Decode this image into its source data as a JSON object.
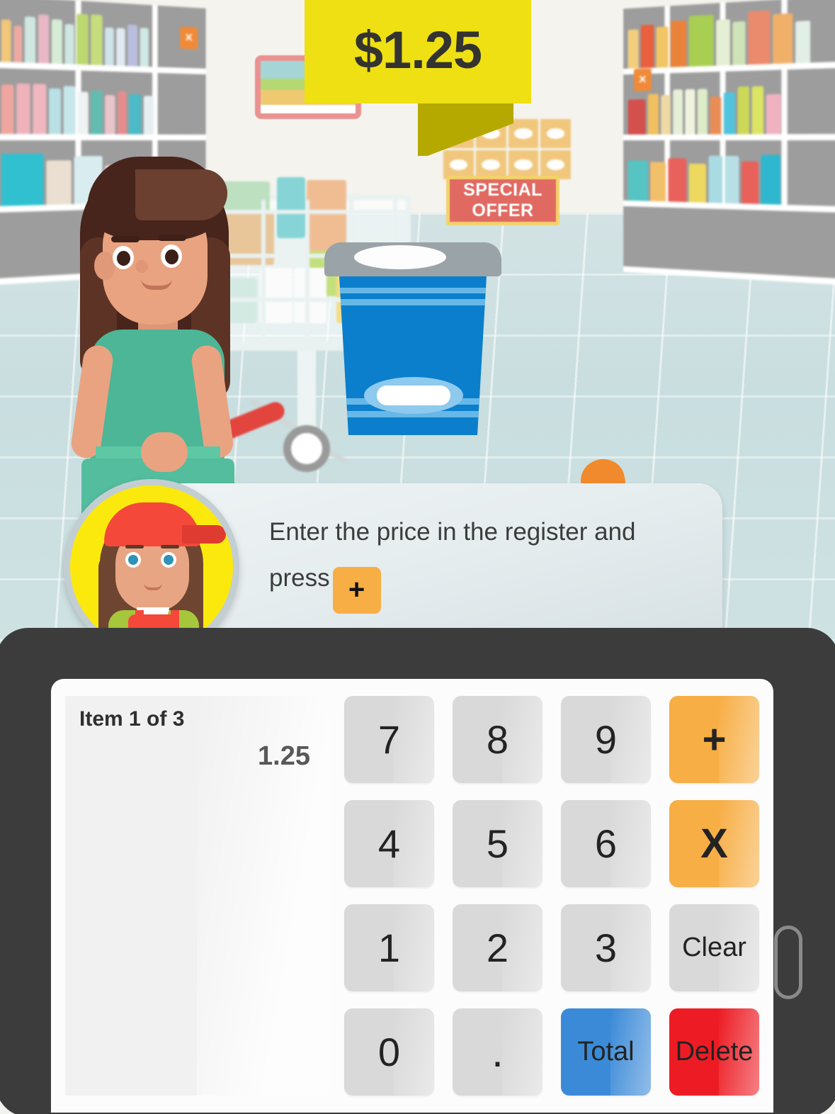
{
  "scene": {
    "price_banner": {
      "label": "$1.25",
      "bg_color": "#efe013",
      "fold_color": "#b5a900"
    },
    "offer_sign": {
      "line1": "SPECIAL",
      "line2": "OFFER",
      "bg_color": "#e06a62",
      "border_color": "#f3d36a"
    },
    "shelf_tag_left": "X",
    "shelf_tag_right": "X"
  },
  "bubble": {
    "text_part1": "Enter the price in the register and press",
    "inline_key": "+",
    "avatar_name": "clerk-avatar"
  },
  "register": {
    "display": {
      "item_label": "Item 1 of 3",
      "entry_value": "1.25"
    },
    "keys": [
      {
        "label": "7",
        "style": "num",
        "name": "key-7"
      },
      {
        "label": "8",
        "style": "num",
        "name": "key-8"
      },
      {
        "label": "9",
        "style": "num",
        "name": "key-9"
      },
      {
        "label": "+",
        "style": "op",
        "name": "key-plus"
      },
      {
        "label": "4",
        "style": "num",
        "name": "key-4"
      },
      {
        "label": "5",
        "style": "num",
        "name": "key-5"
      },
      {
        "label": "6",
        "style": "num",
        "name": "key-6"
      },
      {
        "label": "X",
        "style": "op",
        "name": "key-multiply"
      },
      {
        "label": "1",
        "style": "num",
        "name": "key-1"
      },
      {
        "label": "2",
        "style": "num",
        "name": "key-2"
      },
      {
        "label": "3",
        "style": "num",
        "name": "key-3"
      },
      {
        "label": "Clear",
        "style": "word",
        "name": "key-clear"
      },
      {
        "label": "0",
        "style": "num",
        "name": "key-0"
      },
      {
        "label": ".",
        "style": "dot",
        "name": "key-decimal"
      },
      {
        "label": "Total",
        "style": "total",
        "name": "key-total"
      },
      {
        "label": "Delete",
        "style": "delete",
        "name": "key-delete"
      }
    ],
    "colors": {
      "body": "#3c3c3c",
      "key": "#d9d9d9",
      "operator": "#f7ae45",
      "total": "#3b8ad8",
      "delete": "#ed1c24"
    }
  }
}
